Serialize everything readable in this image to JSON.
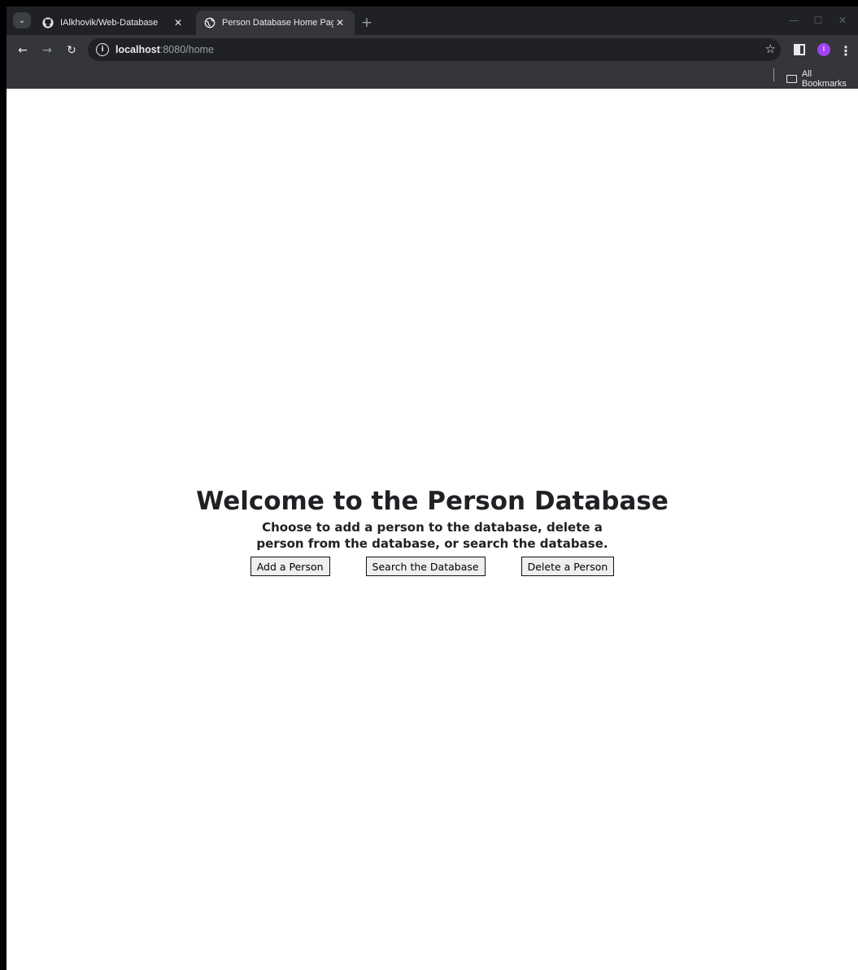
{
  "browser": {
    "tabs": [
      {
        "title": "IAlkhovik/Web-Database",
        "favicon": "github-icon",
        "active": false
      },
      {
        "title": "Person Database Home Page",
        "favicon": "globe-icon",
        "active": true
      }
    ],
    "url_host": "localhost",
    "url_rest": ":8080/home",
    "avatar_initial": "I",
    "bookmarks_label": "All Bookmarks",
    "colors": {
      "frame": "#202124",
      "toolbar": "#35363a",
      "avatar": "#a142f4"
    }
  },
  "page": {
    "heading": "Welcome to the Person Database",
    "subtitle": "Choose to add a person to the database, delete a person from the database, or search the database.",
    "buttons": {
      "add": "Add a Person",
      "search": "Search the Database",
      "delete": "Delete a Person"
    }
  }
}
